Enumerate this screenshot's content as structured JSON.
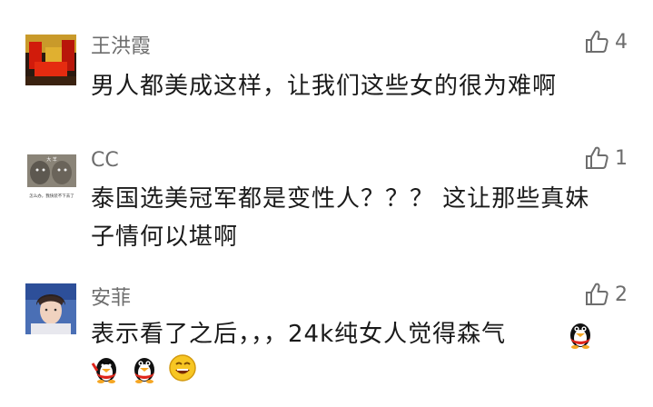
{
  "comments": [
    {
      "name": "王洪霞",
      "likes": "4",
      "text": "男人都美成这样，让我们这些女的很为难啊",
      "avatar": "red-tones-photo"
    },
    {
      "name": "CC",
      "likes": "1",
      "text_line1": "泰国选美冠军都是变性人？？？ 这让那些真妹",
      "text_line2": "子情何以堪啊",
      "avatar": "two-wolves-meme",
      "avatar_caption_top": "大 羊",
      "avatar_caption_bottom": "怎么办，我快装不下去了"
    },
    {
      "name": "安菲",
      "likes": "2",
      "text": "表示看了之后，，，24k纯女人觉得森气",
      "avatar": "man-portrait-photo",
      "emojis": [
        "angry-penguin-icon",
        "penguin-icon",
        "penguin-icon",
        "grin-face-icon"
      ]
    }
  ],
  "icons": {
    "like": "thumbs-up-icon"
  },
  "colors": {
    "name": "#6d6d6d",
    "text": "#1a1a1a",
    "icon": "#6d6d6d"
  }
}
